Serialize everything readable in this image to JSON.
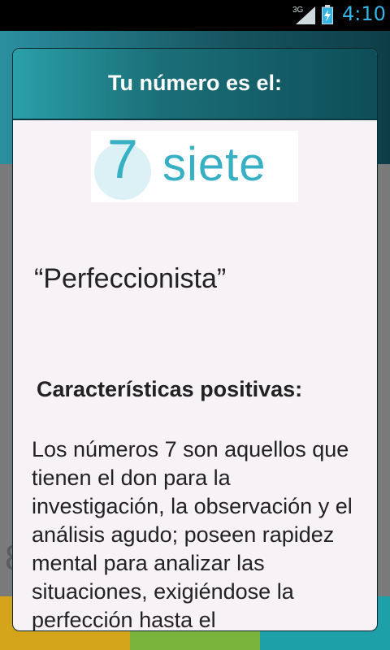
{
  "status_bar": {
    "network": "3G",
    "time": "4:10",
    "icons": [
      "signal-icon",
      "battery-charging-icon"
    ],
    "time_color": "#33b5e5"
  },
  "dialog": {
    "title": "Tu número es el:",
    "logo": {
      "number": "7",
      "word": "siete"
    },
    "quote": "“Perfeccionista”",
    "subheading": "Características positivas:",
    "body": " Los números 7 son aquellos que tienen el don para la investigación, la observación y el análisis agudo; poseen rapidez mental para analizar las situaciones, exigiéndose la perfección hasta el"
  },
  "background": {
    "visible_letter": "8"
  }
}
